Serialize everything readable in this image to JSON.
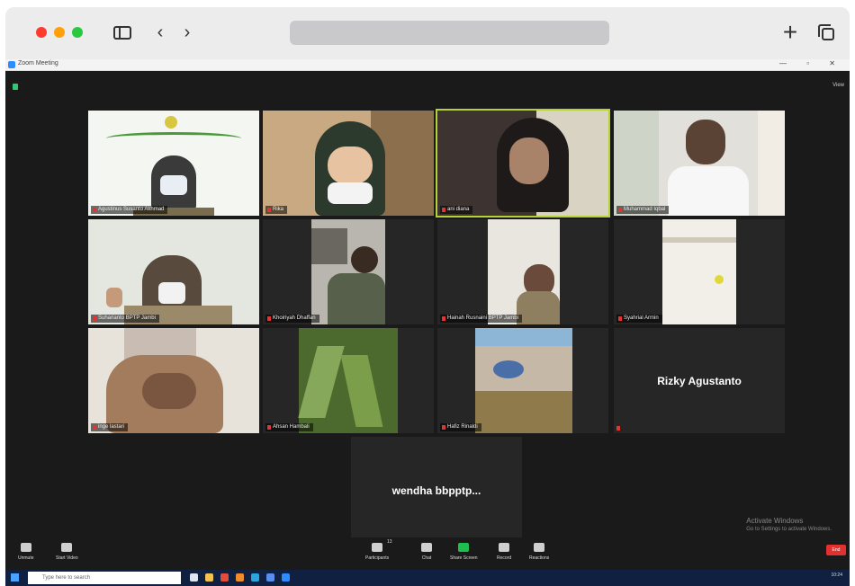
{
  "browser": {
    "address": ""
  },
  "window": {
    "title": "Zoom Meeting",
    "controls": "— ▫ ✕"
  },
  "view_button": "View",
  "participants": [
    {
      "name": "Agustinus Susanto Akhmad",
      "muted": true
    },
    {
      "name": "Rika",
      "muted": true
    },
    {
      "name": "ani diana",
      "muted": false
    },
    {
      "name": "Muhammad Iqbal",
      "muted": true
    },
    {
      "name": "Suharianto BPTP Jambi",
      "muted": true
    },
    {
      "name": "Khoiriyah Dhaffan",
      "muted": true
    },
    {
      "name": "Hainah Rusnaini BPTP Jambi",
      "muted": true
    },
    {
      "name": "Syahrial Armin",
      "muted": true
    },
    {
      "name": "inge lastari",
      "muted": true
    },
    {
      "name": "Ahsan Hambali",
      "muted": true
    },
    {
      "name": "Hafiz Rinaldi",
      "muted": true
    },
    {
      "name": "Rizky Agustanto",
      "muted": true
    },
    {
      "name": "wendha bbpptp...",
      "muted": true
    }
  ],
  "toolbar": {
    "unmute": "Unmute",
    "start_video": "Start Video",
    "participants": "Participants",
    "participants_count": "13",
    "chat": "Chat",
    "share": "Share Screen",
    "record": "Record",
    "reactions": "Reactions",
    "end": "End"
  },
  "watermark": {
    "line1": "Activate Windows",
    "line2": "Go to Settings to activate Windows."
  },
  "taskbar": {
    "search_placeholder": "Type here to search",
    "clock": "10:24"
  }
}
